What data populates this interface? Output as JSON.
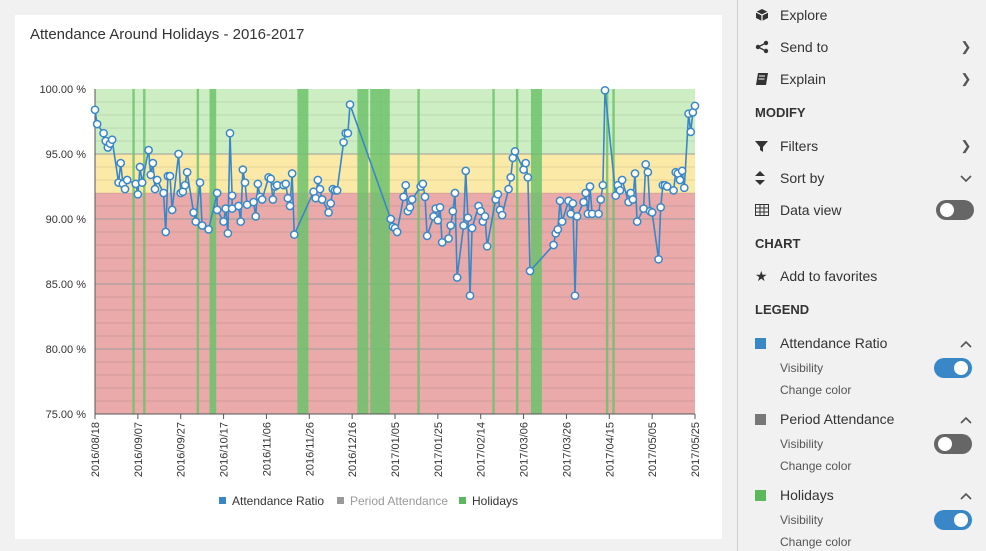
{
  "panel": {
    "explore": "Explore",
    "send_to": "Send to",
    "explain": "Explain",
    "modify_header": "MODIFY",
    "filters": "Filters",
    "sort_by": "Sort by",
    "data_view": "Data view",
    "data_view_on": false,
    "chart_header": "CHART",
    "add_favorites": "Add to favorites",
    "legend_header": "LEGEND",
    "legend_items": [
      {
        "name": "Attendance Ratio",
        "color": "#3a87c8",
        "visibility": "Visibility",
        "visible": true,
        "change_color": "Change color"
      },
      {
        "name": "Period Attendance",
        "color": "#777777",
        "visibility": "Visibility",
        "visible": false,
        "change_color": "Change color"
      },
      {
        "name": "Holidays",
        "color": "#5cb85c",
        "visibility": "Visibility",
        "visible": true,
        "change_color": "Change color"
      }
    ]
  },
  "chart_data": {
    "type": "line",
    "title": "Attendance Around Holidays - 2016-2017",
    "xlabel": "",
    "ylabel": "",
    "ylim": [
      75,
      100
    ],
    "y_ticks": [
      "75.00 %",
      "80.00 %",
      "85.00 %",
      "90.00 %",
      "95.00 %",
      "100.00 %"
    ],
    "x_range": [
      "2016-08-18",
      "2017-05-25"
    ],
    "x_ticks": [
      "2016/08/18",
      "2016/09/07",
      "2016/09/27",
      "2016/10/17",
      "2016/11/06",
      "2016/11/26",
      "2016/12/16",
      "2017/01/05",
      "2017/01/25",
      "2017/02/14",
      "2017/03/06",
      "2017/03/26",
      "2017/04/15",
      "2017/05/05",
      "2017/05/25"
    ],
    "bands": [
      {
        "from": 75,
        "to": 92,
        "color": "#eaaaaa"
      },
      {
        "from": 92,
        "to": 95,
        "color": "#fbe9a8"
      },
      {
        "from": 95,
        "to": 100,
        "color": "#cdeec3"
      }
    ],
    "legend": [
      "Attendance Ratio",
      "Period Attendance",
      "Holidays"
    ],
    "legend_colors": [
      "#3a87c8",
      "#999999",
      "#5cb85c"
    ],
    "legend_placement": "bottom",
    "holidays": [
      [
        "2016-09-05",
        "2016-09-05"
      ],
      [
        "2016-09-10",
        "2016-09-10"
      ],
      [
        "2016-10-05",
        "2016-10-05"
      ],
      [
        "2016-10-11",
        "2016-10-13"
      ],
      [
        "2016-11-21",
        "2016-11-25"
      ],
      [
        "2016-12-19",
        "2016-12-23"
      ],
      [
        "2016-12-25",
        "2016-12-29"
      ],
      [
        "2016-12-30",
        "2017-01-02"
      ],
      [
        "2017-01-16",
        "2017-01-16"
      ],
      [
        "2017-02-20",
        "2017-02-20"
      ],
      [
        "2017-03-03",
        "2017-03-03"
      ],
      [
        "2017-03-10",
        "2017-03-14"
      ],
      [
        "2017-04-14",
        "2017-04-14"
      ],
      [
        "2017-04-17",
        "2017-04-17"
      ]
    ],
    "series": [
      {
        "name": "Attendance Ratio",
        "points": [
          [
            "2016-08-18",
            98.4
          ],
          [
            "2016-08-19",
            97.3
          ],
          [
            "2016-08-22",
            96.6
          ],
          [
            "2016-08-23",
            96.0
          ],
          [
            "2016-08-24",
            95.5
          ],
          [
            "2016-08-25",
            95.8
          ],
          [
            "2016-08-26",
            96.1
          ],
          [
            "2016-08-29",
            92.8
          ],
          [
            "2016-08-30",
            94.3
          ],
          [
            "2016-08-31",
            92.7
          ],
          [
            "2016-09-01",
            92.3
          ],
          [
            "2016-09-02",
            93.0
          ],
          [
            "2016-09-06",
            92.7
          ],
          [
            "2016-09-07",
            91.9
          ],
          [
            "2016-09-08",
            94.0
          ],
          [
            "2016-09-09",
            92.8
          ],
          [
            "2016-09-12",
            95.3
          ],
          [
            "2016-09-13",
            93.4
          ],
          [
            "2016-09-14",
            94.3
          ],
          [
            "2016-09-15",
            92.3
          ],
          [
            "2016-09-16",
            93.0
          ],
          [
            "2016-09-19",
            92.0
          ],
          [
            "2016-09-20",
            89.0
          ],
          [
            "2016-09-21",
            93.3
          ],
          [
            "2016-09-22",
            93.3
          ],
          [
            "2016-09-23",
            90.7
          ],
          [
            "2016-09-26",
            95.0
          ],
          [
            "2016-09-27",
            92.0
          ],
          [
            "2016-09-28",
            92.1
          ],
          [
            "2016-09-29",
            92.6
          ],
          [
            "2016-09-30",
            93.6
          ],
          [
            "2016-10-03",
            90.5
          ],
          [
            "2016-10-04",
            89.8
          ],
          [
            "2016-10-06",
            92.8
          ],
          [
            "2016-10-07",
            89.5
          ],
          [
            "2016-10-10",
            89.2
          ],
          [
            "2016-10-14",
            92.0
          ],
          [
            "2016-10-14",
            90.7
          ],
          [
            "2016-10-17",
            89.8
          ],
          [
            "2016-10-18",
            90.8
          ],
          [
            "2016-10-19",
            88.9
          ],
          [
            "2016-10-20",
            96.6
          ],
          [
            "2016-10-21",
            91.8
          ],
          [
            "2016-10-21",
            90.8
          ],
          [
            "2016-10-24",
            91.0
          ],
          [
            "2016-10-25",
            89.8
          ],
          [
            "2016-10-26",
            93.8
          ],
          [
            "2016-10-27",
            92.8
          ],
          [
            "2016-10-28",
            91.1
          ],
          [
            "2016-10-31",
            91.3
          ],
          [
            "2016-11-01",
            90.2
          ],
          [
            "2016-11-02",
            92.7
          ],
          [
            "2016-11-03",
            91.7
          ],
          [
            "2016-11-04",
            91.5
          ],
          [
            "2016-11-07",
            93.2
          ],
          [
            "2016-11-08",
            93.1
          ],
          [
            "2016-11-09",
            91.5
          ],
          [
            "2016-11-10",
            92.5
          ],
          [
            "2016-11-11",
            92.6
          ],
          [
            "2016-11-14",
            92.6
          ],
          [
            "2016-11-15",
            92.7
          ],
          [
            "2016-11-16",
            91.6
          ],
          [
            "2016-11-17",
            91.0
          ],
          [
            "2016-11-18",
            93.5
          ],
          [
            "2016-11-19",
            88.8
          ],
          [
            "2016-11-28",
            92.1
          ],
          [
            "2016-11-29",
            91.6
          ],
          [
            "2016-11-30",
            93.0
          ],
          [
            "2016-12-01",
            92.3
          ],
          [
            "2016-12-02",
            91.5
          ],
          [
            "2016-12-05",
            90.5
          ],
          [
            "2016-12-06",
            91.2
          ],
          [
            "2016-12-07",
            92.3
          ],
          [
            "2016-12-08",
            92.2
          ],
          [
            "2016-12-09",
            92.2
          ],
          [
            "2016-12-12",
            95.9
          ],
          [
            "2016-12-13",
            96.6
          ],
          [
            "2016-12-14",
            96.6
          ],
          [
            "2016-12-15",
            98.8
          ],
          [
            "2017-01-03",
            90.0
          ],
          [
            "2017-01-04",
            89.4
          ],
          [
            "2017-01-05",
            89.3
          ],
          [
            "2017-01-06",
            89.0
          ],
          [
            "2017-01-09",
            91.7
          ],
          [
            "2017-01-10",
            92.6
          ],
          [
            "2017-01-11",
            90.6
          ],
          [
            "2017-01-12",
            90.9
          ],
          [
            "2017-01-13",
            91.5
          ],
          [
            "2017-01-17",
            92.5
          ],
          [
            "2017-01-18",
            92.7
          ],
          [
            "2017-01-19",
            91.7
          ],
          [
            "2017-01-20",
            88.7
          ],
          [
            "2017-01-23",
            90.2
          ],
          [
            "2017-01-24",
            90.8
          ],
          [
            "2017-01-25",
            89.9
          ],
          [
            "2017-01-26",
            90.9
          ],
          [
            "2017-01-27",
            88.2
          ],
          [
            "2017-01-30",
            88.5
          ],
          [
            "2017-01-31",
            89.5
          ],
          [
            "2017-02-01",
            90.6
          ],
          [
            "2017-02-02",
            92.0
          ],
          [
            "2017-02-03",
            85.5
          ],
          [
            "2017-02-06",
            89.5
          ],
          [
            "2017-02-07",
            93.7
          ],
          [
            "2017-02-08",
            90.1
          ],
          [
            "2017-02-09",
            84.1
          ],
          [
            "2017-02-10",
            89.3
          ],
          [
            "2017-02-13",
            91.0
          ],
          [
            "2017-02-14",
            90.6
          ],
          [
            "2017-02-15",
            89.8
          ],
          [
            "2017-02-16",
            90.2
          ],
          [
            "2017-02-17",
            87.9
          ],
          [
            "2017-02-21",
            91.5
          ],
          [
            "2017-02-22",
            91.9
          ],
          [
            "2017-02-23",
            90.7
          ],
          [
            "2017-02-24",
            90.3
          ],
          [
            "2017-02-27",
            92.3
          ],
          [
            "2017-02-28",
            93.2
          ],
          [
            "2017-03-01",
            94.7
          ],
          [
            "2017-03-02",
            95.2
          ],
          [
            "2017-03-06",
            93.8
          ],
          [
            "2017-03-07",
            94.3
          ],
          [
            "2017-03-08",
            93.2
          ],
          [
            "2017-03-09",
            86.0
          ],
          [
            "2017-03-20",
            88.0
          ],
          [
            "2017-03-21",
            88.9
          ],
          [
            "2017-03-22",
            89.2
          ],
          [
            "2017-03-23",
            91.4
          ],
          [
            "2017-03-24",
            89.8
          ],
          [
            "2017-03-27",
            91.4
          ],
          [
            "2017-03-28",
            90.4
          ],
          [
            "2017-03-29",
            91.2
          ],
          [
            "2017-03-30",
            84.1
          ],
          [
            "2017-03-31",
            90.2
          ],
          [
            "2017-04-03",
            91.3
          ],
          [
            "2017-04-04",
            92.0
          ],
          [
            "2017-04-05",
            90.4
          ],
          [
            "2017-04-06",
            92.5
          ],
          [
            "2017-04-07",
            90.4
          ],
          [
            "2017-04-10",
            90.4
          ],
          [
            "2017-04-11",
            91.5
          ],
          [
            "2017-04-12",
            92.6
          ],
          [
            "2017-04-13",
            99.9
          ],
          [
            "2017-04-18",
            91.8
          ],
          [
            "2017-04-19",
            92.6
          ],
          [
            "2017-04-20",
            92.2
          ],
          [
            "2017-04-21",
            93.0
          ],
          [
            "2017-04-24",
            91.3
          ],
          [
            "2017-04-25",
            92.0
          ],
          [
            "2017-04-26",
            91.5
          ],
          [
            "2017-04-27",
            93.5
          ],
          [
            "2017-04-28",
            89.8
          ],
          [
            "2017-05-01",
            90.8
          ],
          [
            "2017-05-02",
            94.2
          ],
          [
            "2017-05-03",
            93.6
          ],
          [
            "2017-05-04",
            90.6
          ],
          [
            "2017-05-05",
            90.5
          ],
          [
            "2017-05-08",
            86.9
          ],
          [
            "2017-05-09",
            90.9
          ],
          [
            "2017-05-10",
            92.6
          ],
          [
            "2017-05-11",
            92.6
          ],
          [
            "2017-05-12",
            92.5
          ],
          [
            "2017-05-15",
            92.2
          ],
          [
            "2017-05-16",
            93.6
          ],
          [
            "2017-05-17",
            93.5
          ],
          [
            "2017-05-18",
            93.0
          ],
          [
            "2017-05-19",
            93.7
          ],
          [
            "2017-05-20",
            92.4
          ],
          [
            "2017-05-22",
            98.1
          ],
          [
            "2017-05-23",
            96.7
          ],
          [
            "2017-05-24",
            98.2
          ],
          [
            "2017-05-25",
            98.7
          ]
        ]
      }
    ]
  }
}
